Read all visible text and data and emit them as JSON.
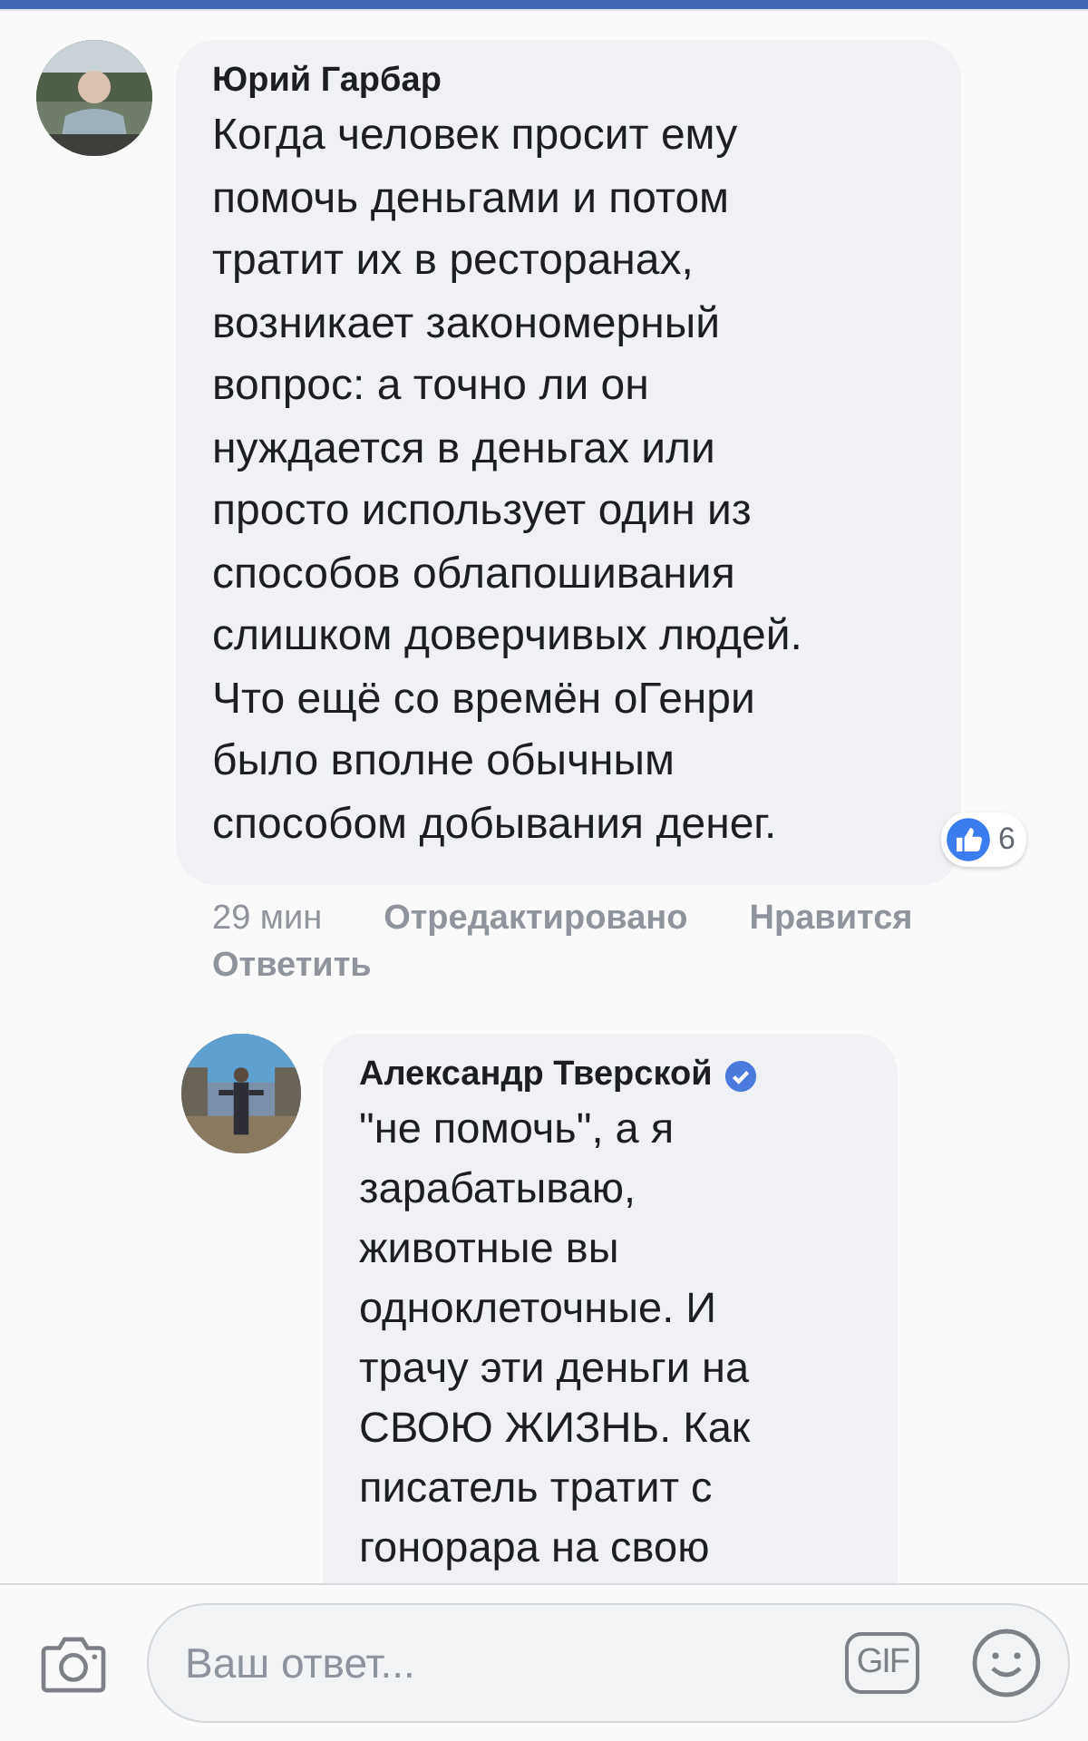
{
  "comments": [
    {
      "author": "Юрий Гарбар",
      "verified": false,
      "text": "Когда человек просит ему\nпомочь деньгами и потом\nтратит их в ресторанах,\nвозникает закономерный\nвопрос: а точно ли он\nнуждается в деньгах или\nпросто использует один из\nспособов облапошивания\nслишком доверчивых людей.\nЧто ещё со времён оГенри\nбыло вполне обычным\nспособом добывания денег.",
      "reaction_count": "6",
      "time": "29 мин",
      "edited": "Отредактировано",
      "actions": [
        "Нравится",
        "Ответить"
      ],
      "replies": [
        {
          "author": "Александр Тверской",
          "verified": true,
          "text": "\"не помочь\", а я\nзарабатываю,\nживотные вы\nодноклеточные. И\nтрачу эти деньги на\nСВОЮ ЖИЗНЬ. Как\nписатель тратит с\nгонорара на свою"
        }
      ]
    }
  ],
  "composer": {
    "placeholder": "Ваш ответ...",
    "gif_label": "GIF"
  }
}
